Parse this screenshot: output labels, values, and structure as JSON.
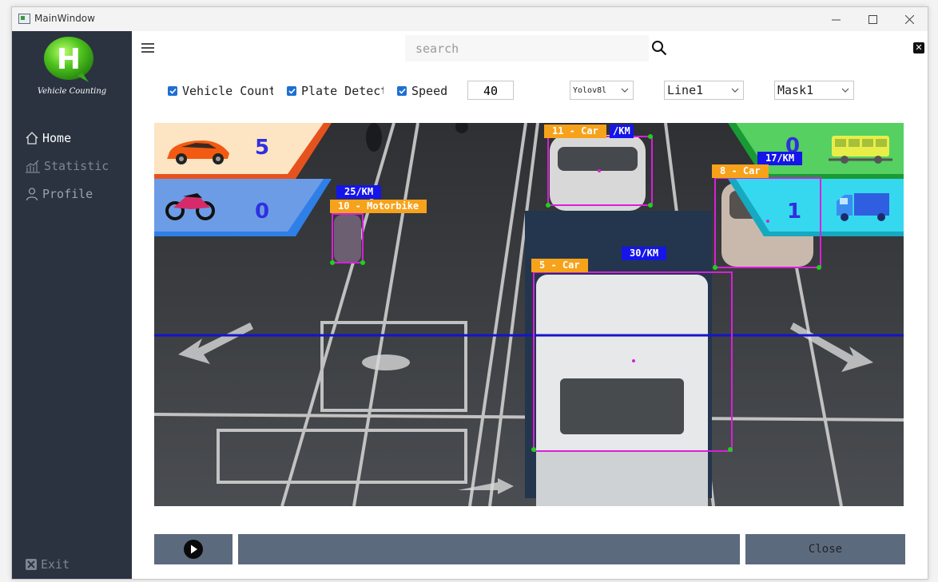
{
  "window": {
    "title": "MainWindow"
  },
  "sidebar": {
    "logo_letter": "H",
    "caption": "Vehicle Counting",
    "items": [
      {
        "label": "Home",
        "color": "#ffffff"
      },
      {
        "label": "Statistic",
        "color": "#7d8694"
      },
      {
        "label": "Profile",
        "color": "#9aa2ad"
      }
    ],
    "exit_label": "Exit"
  },
  "header": {
    "search_placeholder": "search"
  },
  "controls": {
    "vehicle_count": {
      "label": "Vehicle Count",
      "checked": true
    },
    "plate_detect": {
      "label": "Plate Detect",
      "checked": true
    },
    "speed": {
      "label": "Speed",
      "checked": true
    },
    "speed_value": "40",
    "model": "Yolov8l",
    "line": "Line1",
    "mask": "Mask1"
  },
  "video": {
    "counters": {
      "car": "5",
      "motorbike": "0",
      "bus": "0",
      "truck": "1"
    },
    "detections": [
      {
        "label": "11 - Car",
        "speed": "/KM"
      },
      {
        "label": "8 - Car",
        "speed": "17/KM"
      },
      {
        "label": "10 - Motorbike",
        "speed": "25/KM"
      },
      {
        "label": "5 - Car",
        "speed": "30/KM"
      }
    ]
  },
  "bottom": {
    "close_label": "Close"
  },
  "colors": {
    "sidebar_bg": "#2b3340",
    "accent": "#1e6fd0",
    "box": "#d91fd9",
    "label_bg": "#f7a21b",
    "speed_bg": "#1515ea",
    "count_line": "#1515c8"
  }
}
